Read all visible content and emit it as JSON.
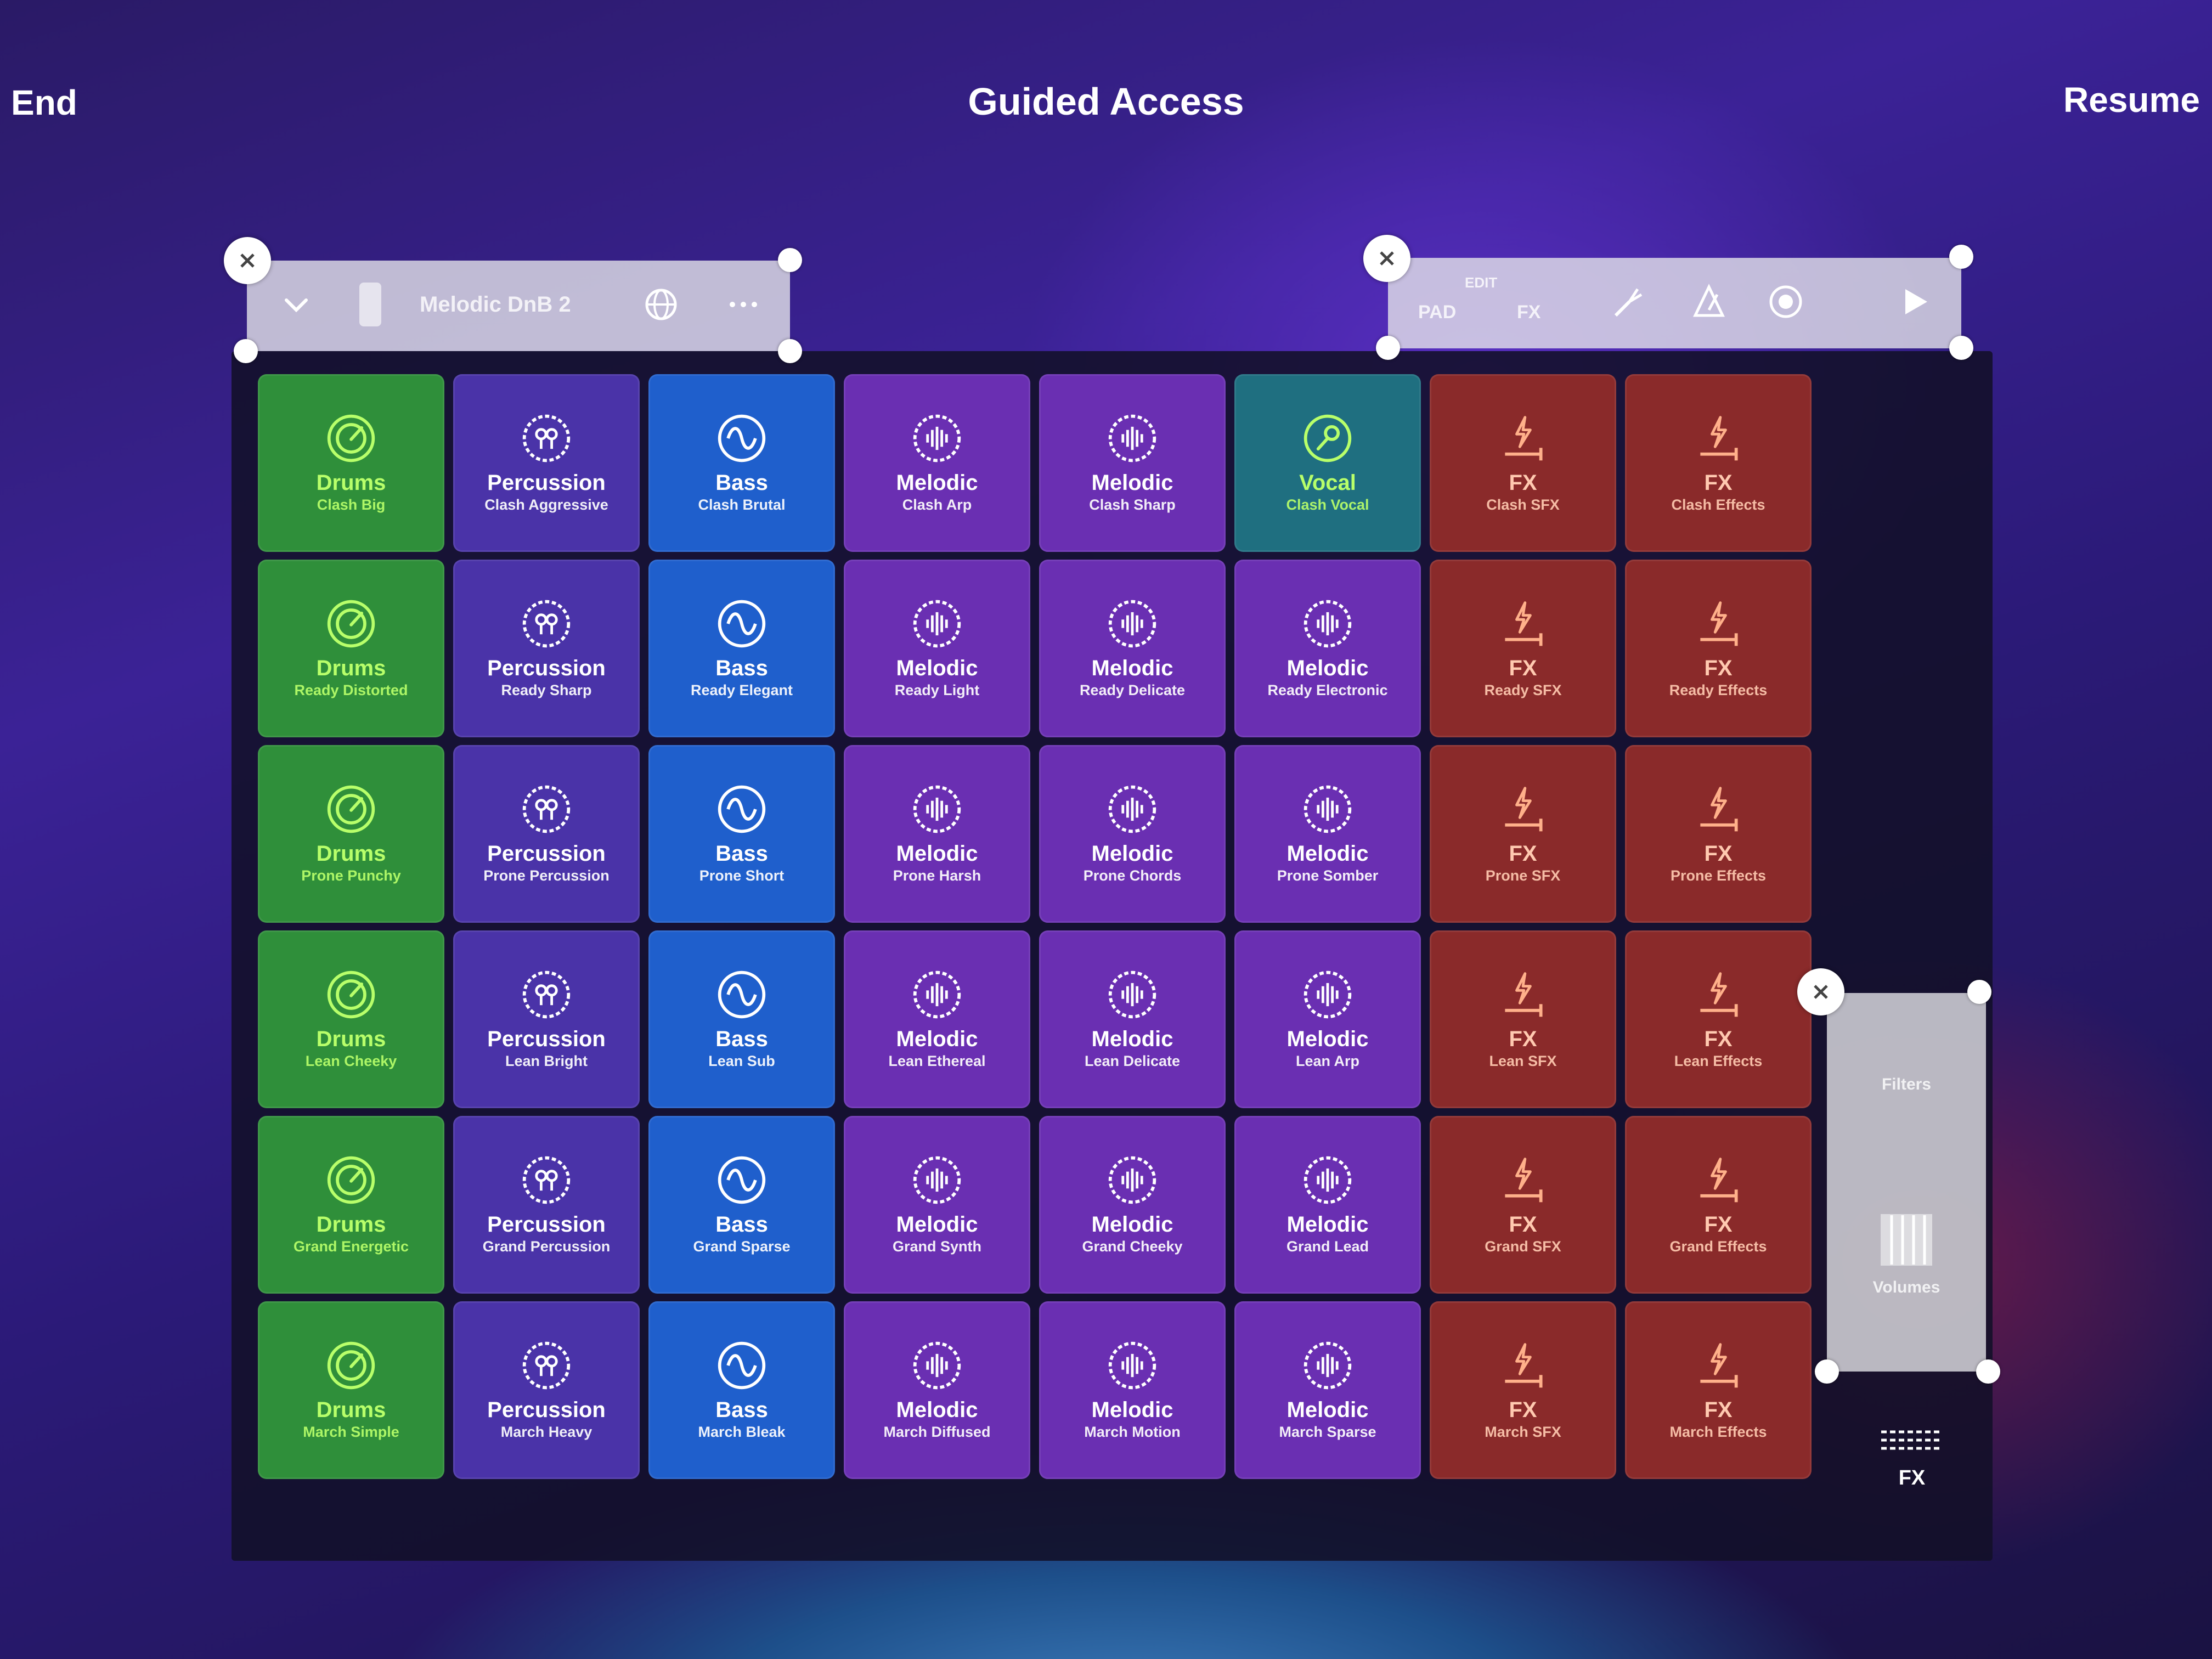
{
  "top_bar": {
    "end_label": "End",
    "title": "Guided Access",
    "resume_label": "Resume"
  },
  "toolbar_left": {
    "project_name": "Melodic DnB 2"
  },
  "toolbar_right": {
    "edit_label": "EDIT",
    "pad_label": "PAD",
    "fx_label": "FX"
  },
  "side_panel": {
    "filters_label": "Filters",
    "volumes_label": "Volumes"
  },
  "fx_button": {
    "label": "FX"
  },
  "pads": [
    [
      {
        "type": "Drums",
        "name": "Clash Big"
      },
      {
        "type": "Percussion",
        "name": "Clash Aggressive"
      },
      {
        "type": "Bass",
        "name": "Clash Brutal"
      },
      {
        "type": "Melodic",
        "name": "Clash Arp"
      },
      {
        "type": "Melodic",
        "name": "Clash Sharp"
      },
      {
        "type": "Vocal",
        "name": "Clash Vocal"
      },
      {
        "type": "FX",
        "name": "Clash SFX"
      },
      {
        "type": "FX",
        "name": "Clash Effects"
      }
    ],
    [
      {
        "type": "Drums",
        "name": "Ready Distorted"
      },
      {
        "type": "Percussion",
        "name": "Ready Sharp"
      },
      {
        "type": "Bass",
        "name": "Ready Elegant"
      },
      {
        "type": "Melodic",
        "name": "Ready Light"
      },
      {
        "type": "Melodic",
        "name": "Ready Delicate"
      },
      {
        "type": "Melodic",
        "name": "Ready Electronic"
      },
      {
        "type": "FX",
        "name": "Ready SFX"
      },
      {
        "type": "FX",
        "name": "Ready Effects"
      }
    ],
    [
      {
        "type": "Drums",
        "name": "Prone Punchy"
      },
      {
        "type": "Percussion",
        "name": "Prone Percussion"
      },
      {
        "type": "Bass",
        "name": "Prone Short"
      },
      {
        "type": "Melodic",
        "name": "Prone Harsh"
      },
      {
        "type": "Melodic",
        "name": "Prone Chords"
      },
      {
        "type": "Melodic",
        "name": "Prone Somber"
      },
      {
        "type": "FX",
        "name": "Prone SFX"
      },
      {
        "type": "FX",
        "name": "Prone Effects"
      }
    ],
    [
      {
        "type": "Drums",
        "name": "Lean Cheeky"
      },
      {
        "type": "Percussion",
        "name": "Lean Bright"
      },
      {
        "type": "Bass",
        "name": "Lean Sub"
      },
      {
        "type": "Melodic",
        "name": "Lean Ethereal"
      },
      {
        "type": "Melodic",
        "name": "Lean Delicate"
      },
      {
        "type": "Melodic",
        "name": "Lean Arp"
      },
      {
        "type": "FX",
        "name": "Lean SFX"
      },
      {
        "type": "FX",
        "name": "Lean Effects"
      }
    ],
    [
      {
        "type": "Drums",
        "name": "Grand Energetic"
      },
      {
        "type": "Percussion",
        "name": "Grand Percussion"
      },
      {
        "type": "Bass",
        "name": "Grand Sparse"
      },
      {
        "type": "Melodic",
        "name": "Grand Synth"
      },
      {
        "type": "Melodic",
        "name": "Grand Cheeky"
      },
      {
        "type": "Melodic",
        "name": "Grand Lead"
      },
      {
        "type": "FX",
        "name": "Grand SFX"
      },
      {
        "type": "FX",
        "name": "Grand Effects"
      }
    ],
    [
      {
        "type": "Drums",
        "name": "March Simple"
      },
      {
        "type": "Percussion",
        "name": "March Heavy"
      },
      {
        "type": "Bass",
        "name": "March Bleak"
      },
      {
        "type": "Melodic",
        "name": "March Diffused"
      },
      {
        "type": "Melodic",
        "name": "March Motion"
      },
      {
        "type": "Melodic",
        "name": "March Sparse"
      },
      {
        "type": "FX",
        "name": "March SFX"
      },
      {
        "type": "FX",
        "name": "March Effects"
      }
    ]
  ],
  "colors": {
    "drums": "#2f8f3a",
    "percussion": "#4a33a8",
    "bass": "#1f5fcc",
    "melodic": "#6a2fb2",
    "vocal": "#1f6f80",
    "fx": "#8a2a2a",
    "accent_green": "#b8ff6a"
  }
}
